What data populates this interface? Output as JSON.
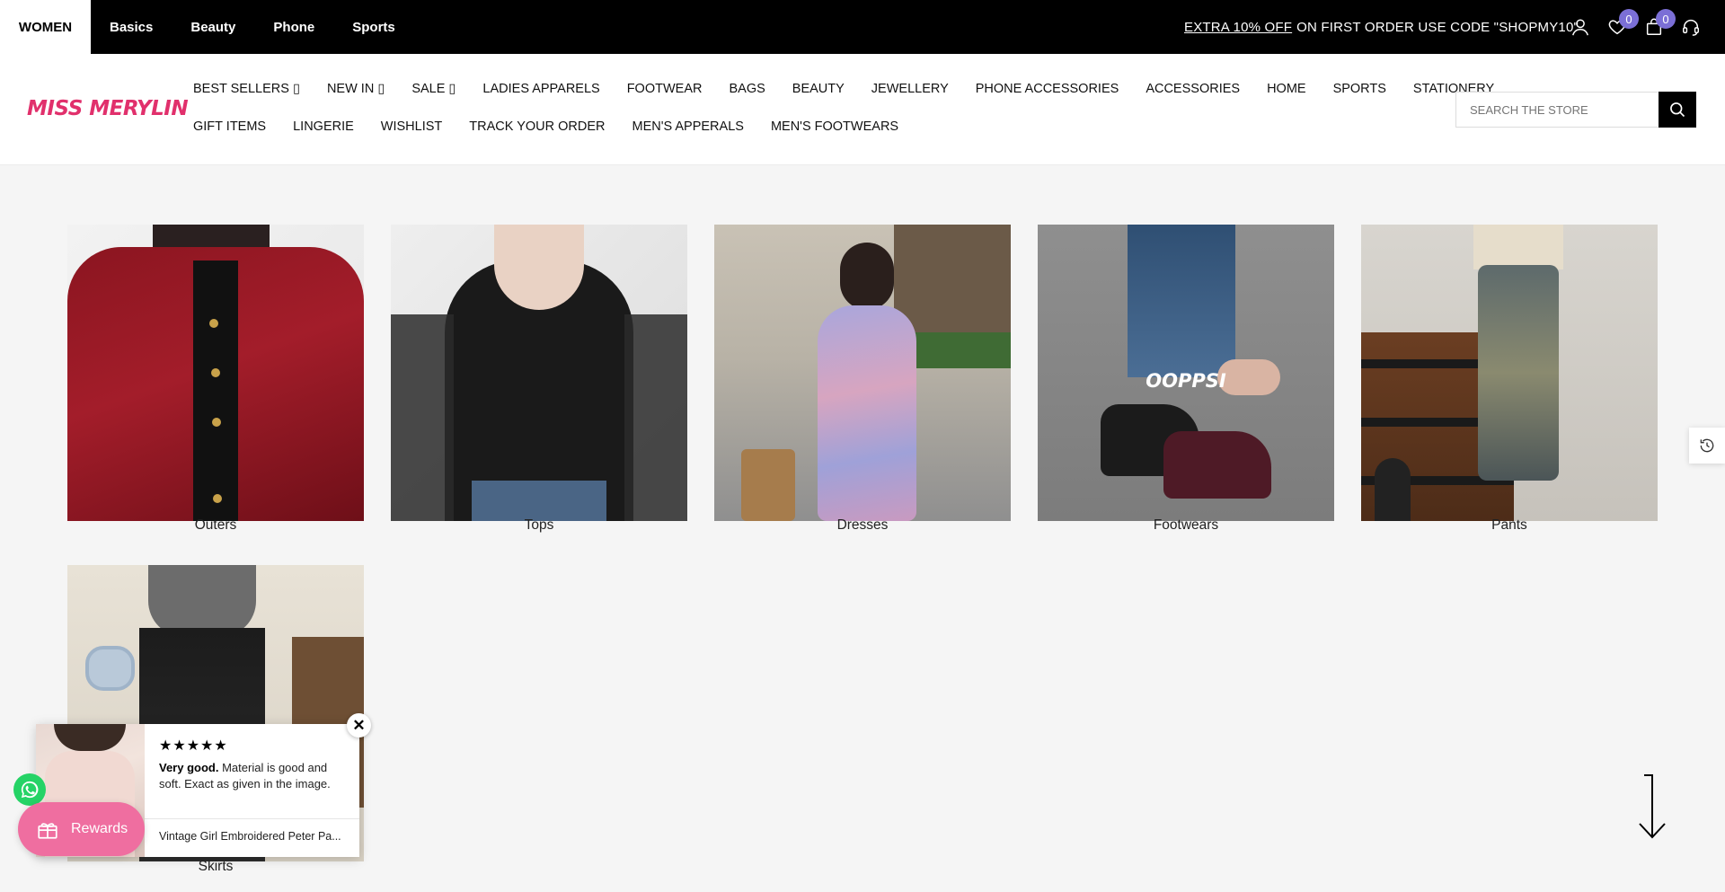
{
  "topbar": {
    "categories": [
      "WOMEN",
      "Basics",
      "Beauty",
      "Phone",
      "Sports"
    ],
    "promo_link": "EXTRA 10% OFF",
    "promo_rest": "ON FIRST ORDER USE CODE \"SHOPMY10\"",
    "icons": [
      "user-icon",
      "heart-icon",
      "bag-icon",
      "headset-icon"
    ],
    "wishlist_count": "0",
    "cart_count": "0"
  },
  "header": {
    "logo": "MISS MERYLIN",
    "nav_row1": [
      "BEST SELLERS ▯",
      "NEW IN ▯",
      "SALE ▯",
      "LADIES APPARELS",
      "FOOTWEAR",
      "BAGS",
      "BEAUTY",
      "JEWELLERY",
      "PHONE ACCESSORIES",
      "ACCESSORIES",
      "HOME",
      "SPORTS",
      "STATIONERY"
    ],
    "nav_row2": [
      "GIFT ITEMS",
      "LINGERIE",
      "WISHLIST",
      "TRACK YOUR ORDER",
      "MEN'S APPERALS",
      "MEN'S FOOTWEARS"
    ],
    "search_placeholder": "SEARCH THE STORE"
  },
  "collections": [
    {
      "label": "Outers"
    },
    {
      "label": "Tops"
    },
    {
      "label": "Dresses"
    },
    {
      "label": "Footwears",
      "overlay": "OOPPSI"
    },
    {
      "label": "Pants"
    },
    {
      "label": "Skirts"
    }
  ],
  "review_popup": {
    "stars": "★★★★★",
    "rating": 5,
    "headline": "Very good.",
    "text": "Material is good and soft. Exact as given in the image.",
    "product": "Vintage Girl Embroidered Peter Pa...",
    "close": "✕"
  },
  "rewards": {
    "label": "Rewards"
  },
  "colors": {
    "accent": "#e1306c",
    "badge": "#7b6fd6",
    "rewards": "#ef6ea0",
    "whatsapp": "#25d366"
  }
}
